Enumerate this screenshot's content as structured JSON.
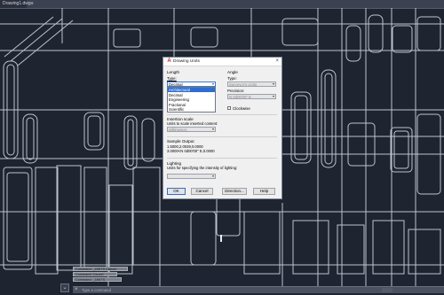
{
  "tabs": {
    "active_label": "Drawing1.dwg",
    "add_label": "+"
  },
  "dialog": {
    "title": "Drawing Units",
    "close_glyph": "×",
    "length": {
      "group_label": "Length",
      "type_label": "Type:",
      "type_value": "Decimal",
      "dropdown_options": [
        "Architectural",
        "Decimal",
        "Engineering",
        "Fractional",
        "Scientific"
      ],
      "selected_option": "Architectural"
    },
    "angle": {
      "group_label": "Angle",
      "type_label": "Type:",
      "type_value": "Surveyor's Units",
      "precision_label": "Precision:",
      "precision_value": "N 0d00'00\" E",
      "clockwise_label": "Clockwise"
    },
    "insertion": {
      "group_label": "Insertion scale",
      "units_label": "Units to scale inserted content:",
      "units_value": "Millimeters"
    },
    "sample": {
      "group_label": "Sample Output",
      "line1": "1.5000,2.0039,0.0000",
      "line2": "3.0000<N 0d00'00\" E,0.0000"
    },
    "lighting": {
      "group_label": "Lighting",
      "units_label": "Units for specifying the intensity of lighting:"
    },
    "buttons": {
      "ok": "OK",
      "cancel": "Cancel",
      "direction": "Direction...",
      "help": "Help"
    }
  },
  "command": {
    "history": [
      "Command: _UNITS Cancel",
      "Command: Cancel",
      "Command: _UNITS"
    ],
    "placeholder": "Type a command",
    "close_glyph": "×",
    "menu_glyph": "⌄"
  },
  "colors": {
    "background": "#1e2430",
    "lines": "#cfd6e0",
    "selection": "#2e6ecf",
    "logo": "#cc2b2b"
  }
}
